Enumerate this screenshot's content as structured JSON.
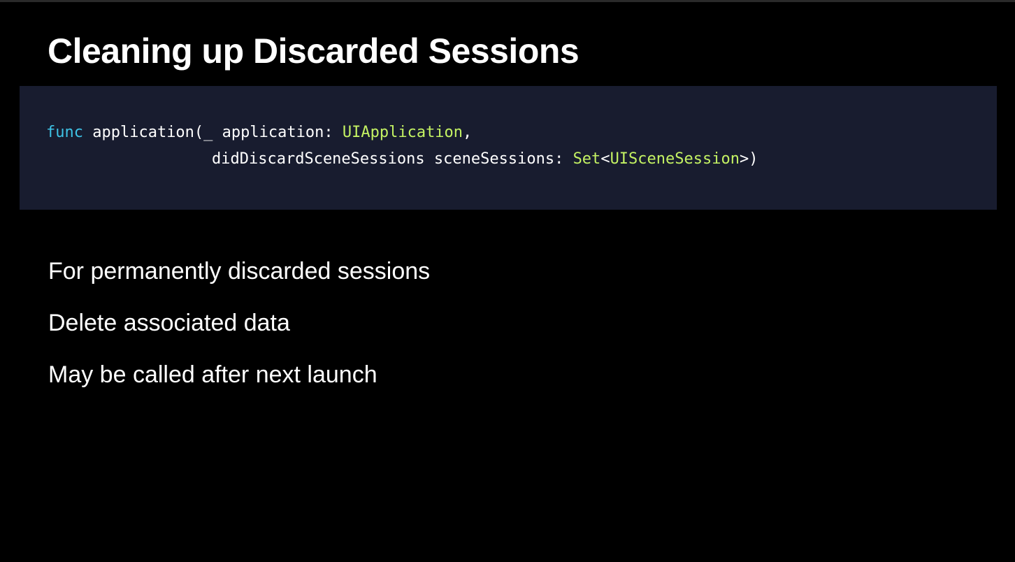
{
  "slide": {
    "title": "Cleaning up Discarded Sessions",
    "code": {
      "line1": {
        "keyword": "func",
        "text_a": " application(_ application: ",
        "type_a": "UIApplication",
        "text_b": ","
      },
      "line2": {
        "text_a": "didDiscardSceneSessions sceneSessions: ",
        "type_set": "Set",
        "text_lt": "<",
        "type_session": "UISceneSession",
        "text_end": ">)"
      }
    },
    "bullets": [
      "For permanently discarded sessions",
      "Delete associated data",
      "May be called after next launch"
    ]
  },
  "colors": {
    "background": "#000000",
    "code_background": "#181c2f",
    "keyword": "#3ec3e6",
    "type": "#c4f263",
    "text": "#ffffff"
  }
}
